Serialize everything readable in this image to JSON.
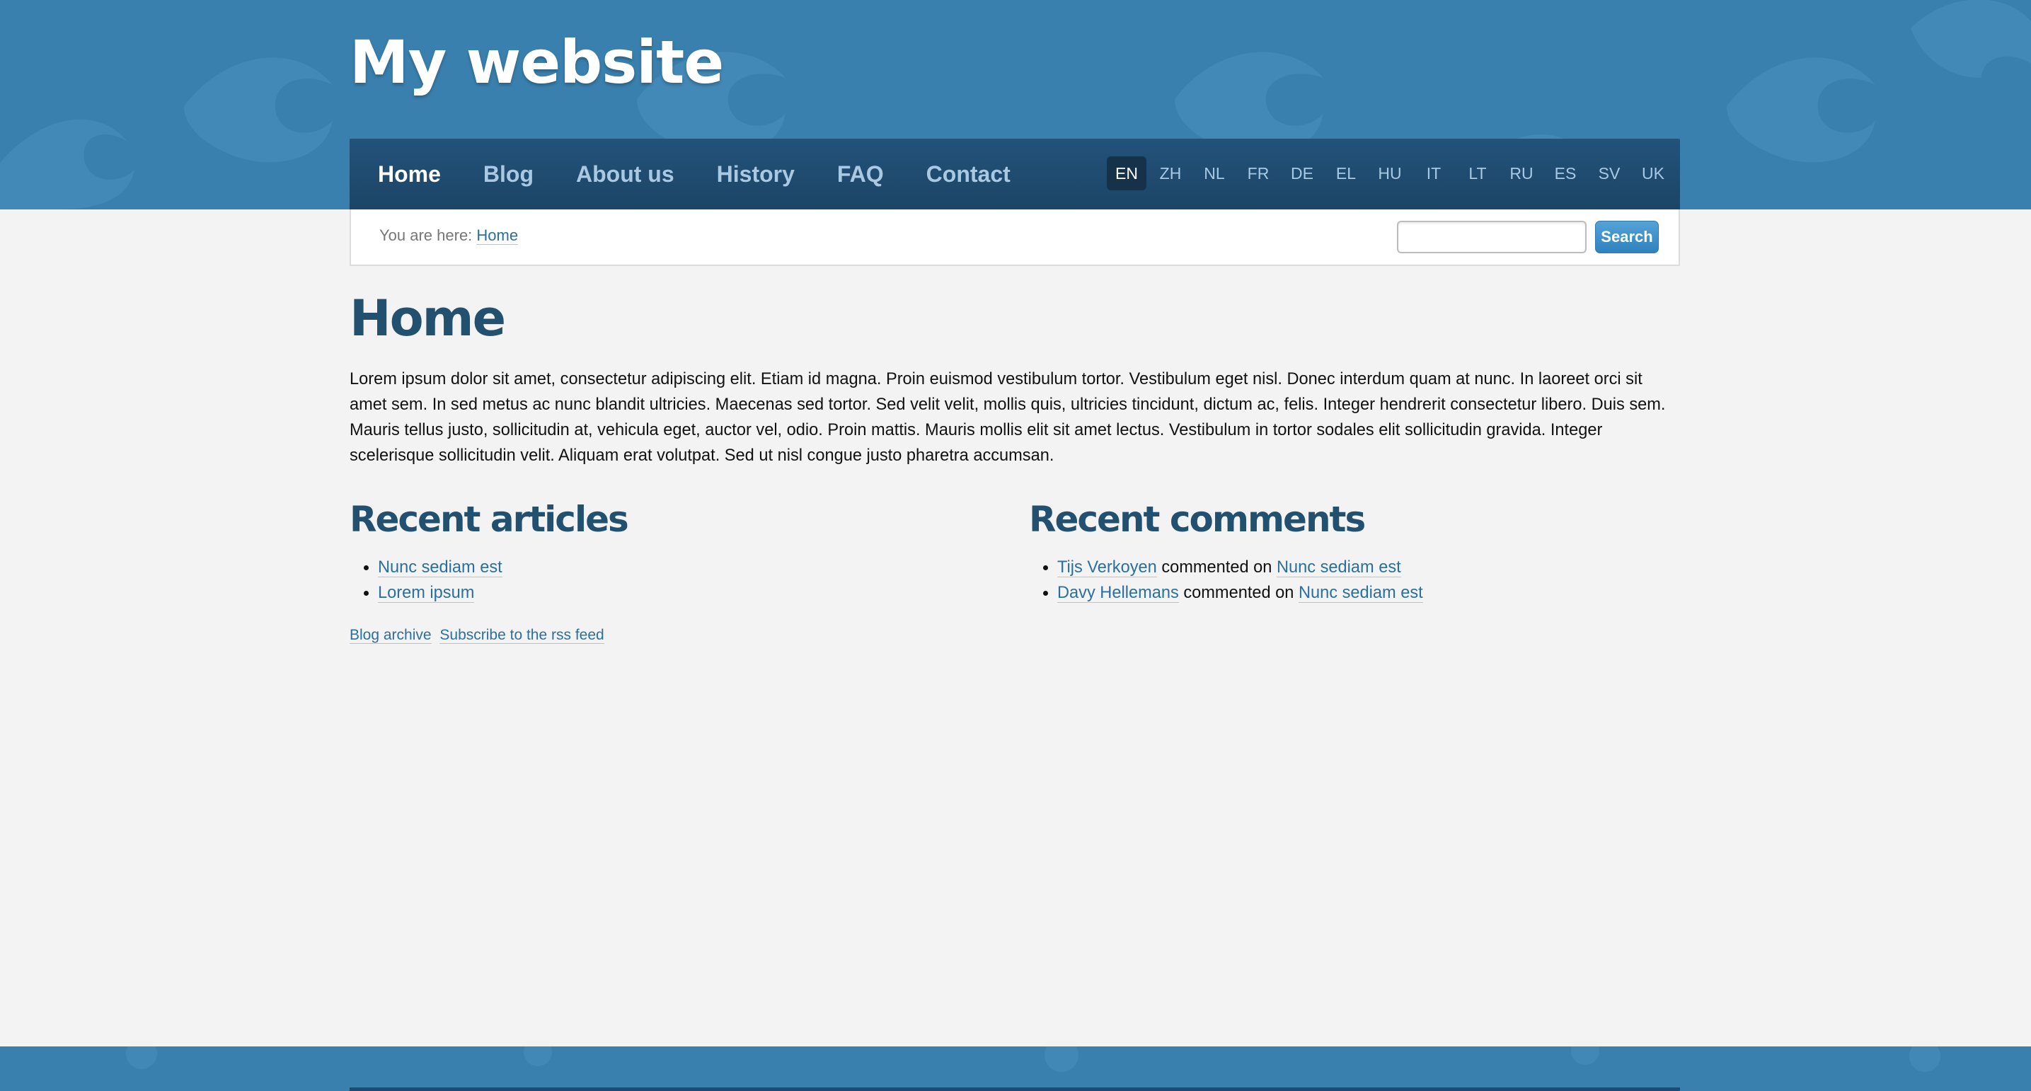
{
  "site": {
    "title": "My website"
  },
  "nav": {
    "items": [
      {
        "label": "Home",
        "active": true
      },
      {
        "label": "Blog"
      },
      {
        "label": "About us"
      },
      {
        "label": "History"
      },
      {
        "label": "FAQ"
      },
      {
        "label": "Contact"
      }
    ]
  },
  "languages": {
    "items": [
      "EN",
      "ZH",
      "NL",
      "FR",
      "DE",
      "EL",
      "HU",
      "IT",
      "LT",
      "RU",
      "ES",
      "SV",
      "UK"
    ],
    "active": "EN"
  },
  "breadcrumb": {
    "prefix": "You are here:",
    "current": "Home"
  },
  "search": {
    "value": "",
    "button_label": "Search"
  },
  "page": {
    "title": "Home",
    "intro": "Lorem ipsum dolor sit amet, consectetur adipiscing elit. Etiam id magna. Proin euismod vestibulum tortor. Vestibulum eget nisl. Donec interdum quam at nunc. In laoreet orci sit amet sem. In sed metus ac nunc blandit ultricies. Maecenas sed tortor. Sed velit velit, mollis quis, ultricies tincidunt, dictum ac, felis. Integer hendrerit consectetur libero. Duis sem. Mauris tellus justo, sollicitudin at, vehicula eget, auctor vel, odio. Proin mattis. Mauris mollis elit sit amet lectus. Vestibulum in tortor sodales elit sollicitudin gravida. Integer scelerisque sollicitudin velit. Aliquam erat volutpat. Sed ut nisl congue justo pharetra accumsan."
  },
  "recent_articles": {
    "title": "Recent articles",
    "items": [
      "Nunc sediam est",
      "Lorem ipsum"
    ],
    "links": {
      "archive": "Blog archive",
      "rss": "Subscribe to the rss feed"
    }
  },
  "recent_comments": {
    "title": "Recent comments",
    "connector": "commented on",
    "items": [
      {
        "author": "Tijs Verkoyen",
        "article": "Nunc sediam est"
      },
      {
        "author": "Davy Hellemans",
        "article": "Nunc sediam est"
      }
    ]
  },
  "colors": {
    "header_blue": "#3a80ae",
    "nav_dark": "#1f4b6e",
    "heading": "#22506f",
    "link": "#2a6fa0",
    "background": "#f3f3f3"
  }
}
